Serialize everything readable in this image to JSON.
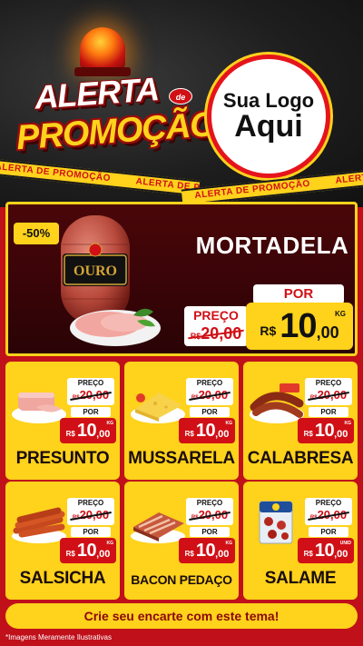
{
  "header": {
    "title_top": "ALERTA",
    "title_de": "de",
    "title_bottom": "PROMOÇÃO",
    "logo_line1": "Sua Logo",
    "logo_line2": "Aqui",
    "tape_text": "ALERTA DE PROMOÇÃO"
  },
  "hero": {
    "discount": "-50%",
    "brand": "OURO",
    "name": "MORTADELA",
    "por_label": "POR",
    "preco_label": "PREÇO",
    "old_currency": "R$",
    "old_price": "20,00",
    "currency": "R$",
    "price_int": "10",
    "price_dec": ",00",
    "unit": "KG"
  },
  "products": [
    {
      "name": "PRESUNTO",
      "preco_label": "PREÇO",
      "old_currency": "R$",
      "old_price": "20,00",
      "por_label": "POR",
      "currency": "R$",
      "price_int": "10",
      "price_dec": ",00",
      "unit": "KG"
    },
    {
      "name": "MUSSARELA",
      "preco_label": "PREÇO",
      "old_currency": "R$",
      "old_price": "20,00",
      "por_label": "POR",
      "currency": "R$",
      "price_int": "10",
      "price_dec": ",00",
      "unit": "KG"
    },
    {
      "name": "CALABRESA",
      "preco_label": "PREÇO",
      "old_currency": "R$",
      "old_price": "20,00",
      "por_label": "POR",
      "currency": "R$",
      "price_int": "10",
      "price_dec": ",00",
      "unit": "KG"
    },
    {
      "name": "SALSICHA",
      "preco_label": "PREÇO",
      "old_currency": "R$",
      "old_price": "20,00",
      "por_label": "POR",
      "currency": "R$",
      "price_int": "10",
      "price_dec": ",00",
      "unit": "KG"
    },
    {
      "name": "BACON PEDAÇO",
      "preco_label": "PREÇO",
      "old_currency": "R$",
      "old_price": "20,00",
      "por_label": "POR",
      "currency": "R$",
      "price_int": "10",
      "price_dec": ",00",
      "unit": "KG"
    },
    {
      "name": "SALAME",
      "preco_label": "PREÇO",
      "old_currency": "R$",
      "old_price": "20,00",
      "por_label": "POR",
      "currency": "R$",
      "price_int": "10",
      "price_dec": ",00",
      "unit": "UNID"
    }
  ],
  "footer": {
    "cta": "Crie seu encarte com este tema!",
    "disclaimer": "*Imagens Meramente Ilustrativas"
  },
  "colors": {
    "red": "#d01016",
    "yellow": "#ffd21c",
    "dark": "#1e1e1e"
  }
}
